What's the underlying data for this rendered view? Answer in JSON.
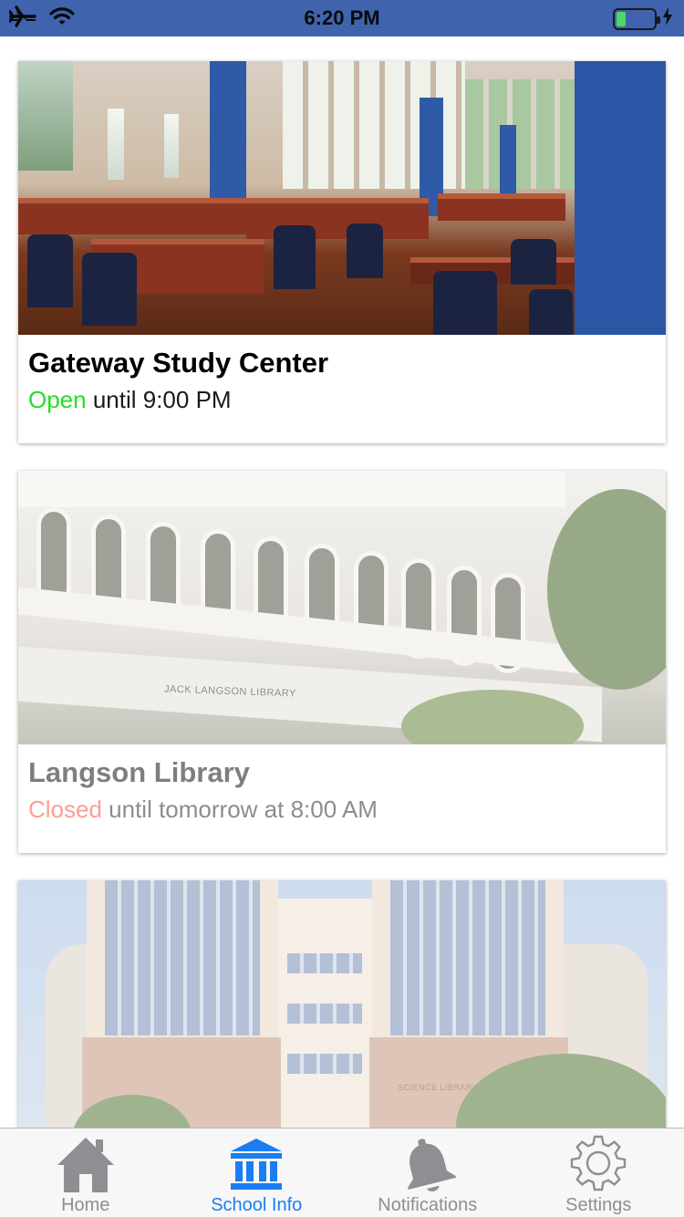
{
  "status_bar": {
    "time": "6:20 PM",
    "battery_level": 0.25,
    "color": "#3f63ad"
  },
  "locations": [
    {
      "name": "Gateway Study Center",
      "status_word": "Open",
      "status_rest": " until 9:00 PM",
      "status_color": "#22e022",
      "open": true
    },
    {
      "name": "Langson Library",
      "status_word": "Closed",
      "status_rest": " until tomorrow at 8:00 AM",
      "status_color": "#ff3b30",
      "open": false,
      "photo_sign": "JACK LANGSON LIBRARY"
    },
    {
      "photo_sign": "SCIENCE LIBRARY"
    }
  ],
  "tab_bar": {
    "tabs": [
      {
        "label": "Home",
        "icon": "home-icon"
      },
      {
        "label": "School Info",
        "icon": "school-building-icon"
      },
      {
        "label": "Notifications",
        "icon": "bell-icon"
      },
      {
        "label": "Settings",
        "icon": "gear-icon"
      }
    ],
    "active_color": "#1b7cf3",
    "inactive_color": "#8e8e93"
  }
}
